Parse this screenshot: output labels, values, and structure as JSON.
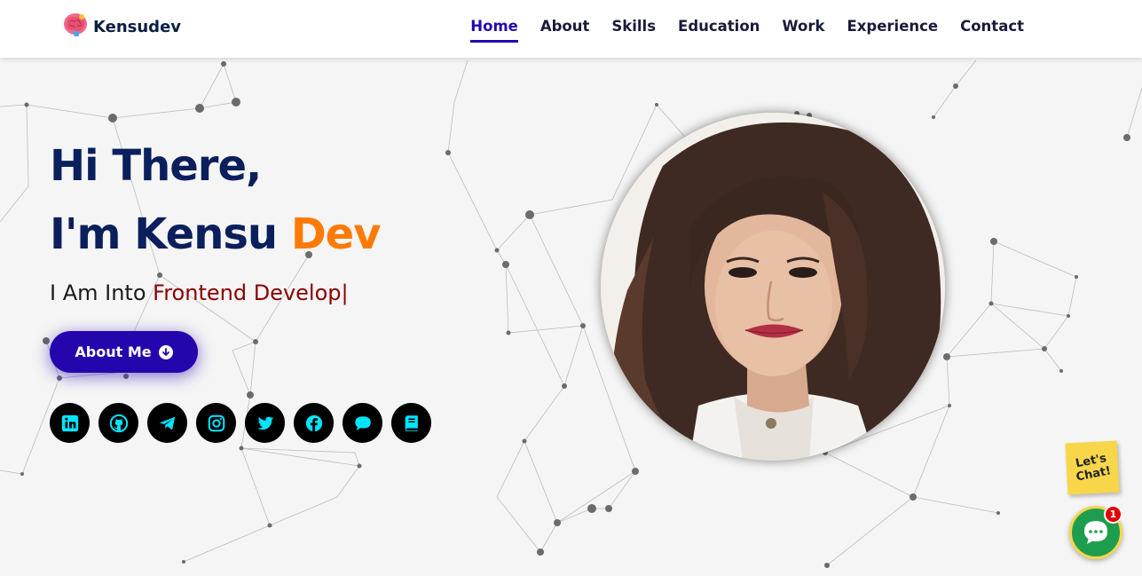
{
  "brand": {
    "name": "Kensudev",
    "logo_icon": "brain-icon"
  },
  "nav": {
    "items": [
      {
        "label": "Home",
        "active": true
      },
      {
        "label": "About",
        "active": false
      },
      {
        "label": "Skills",
        "active": false
      },
      {
        "label": "Education",
        "active": false
      },
      {
        "label": "Work",
        "active": false
      },
      {
        "label": "Experience",
        "active": false
      },
      {
        "label": "Contact",
        "active": false
      }
    ]
  },
  "hero": {
    "greeting": "Hi There,",
    "intro_prefix": "I'm Kensu ",
    "intro_accent": "Dev",
    "sub_prefix": "I Am Into ",
    "sub_typed": "Frontend Develop",
    "cursor": "|",
    "button_label": "About Me",
    "button_icon": "arrow-down-circle-icon"
  },
  "socials": [
    {
      "name": "linkedin",
      "icon": "linkedin-icon"
    },
    {
      "name": "github",
      "icon": "github-icon"
    },
    {
      "name": "telegram",
      "icon": "telegram-icon"
    },
    {
      "name": "instagram",
      "icon": "instagram-icon"
    },
    {
      "name": "twitter",
      "icon": "twitter-icon"
    },
    {
      "name": "facebook",
      "icon": "facebook-icon"
    },
    {
      "name": "chat",
      "icon": "chat-icon"
    },
    {
      "name": "blog",
      "icon": "book-icon"
    }
  ],
  "chat_widget": {
    "note_text": "Let's Chat!",
    "badge_count": "1"
  },
  "colors": {
    "primary": "#2506ad",
    "accent": "#ff7a00",
    "heading": "#0a1f5c",
    "typed_text": "#8b0000",
    "social_icon": "#00e5ff",
    "chat_green": "#1f9d4e",
    "chat_note": "#f7d64a"
  }
}
